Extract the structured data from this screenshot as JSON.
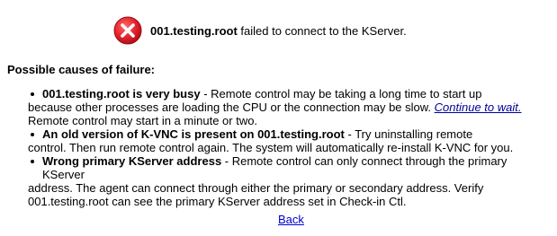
{
  "header": {
    "icon": "error-icon",
    "machine_name": "001.testing.root",
    "message": "failed to connect to the KServer.",
    "icon_color": "#e8232c"
  },
  "section": {
    "title": "Possible causes of failure:"
  },
  "causes": [
    {
      "lead": "001.testing.root is very busy",
      "line1": " - Remote control may be taking a long time to start up",
      "line2a": "because other processes are loading the CPU or the connection may be slow. ",
      "link": "Continue to wait.",
      "line3": "Remote control may start in a minute or two."
    },
    {
      "lead": "An old version of K-VNC is present on 001.testing.root",
      "line1": " - Try uninstalling remote",
      "line2": "control. Then run remote control again. The system will automatically re-install K-VNC for you."
    },
    {
      "lead": "Wrong primary KServer address",
      "line1": " - Remote control can only connect through the primary KServer",
      "line2": "address. The agent can connect through either the primary or secondary address. Verify",
      "line3": "001.testing.root can see the primary KServer address set in Check-in Ctl."
    }
  ],
  "footer": {
    "back_label": "Back"
  }
}
